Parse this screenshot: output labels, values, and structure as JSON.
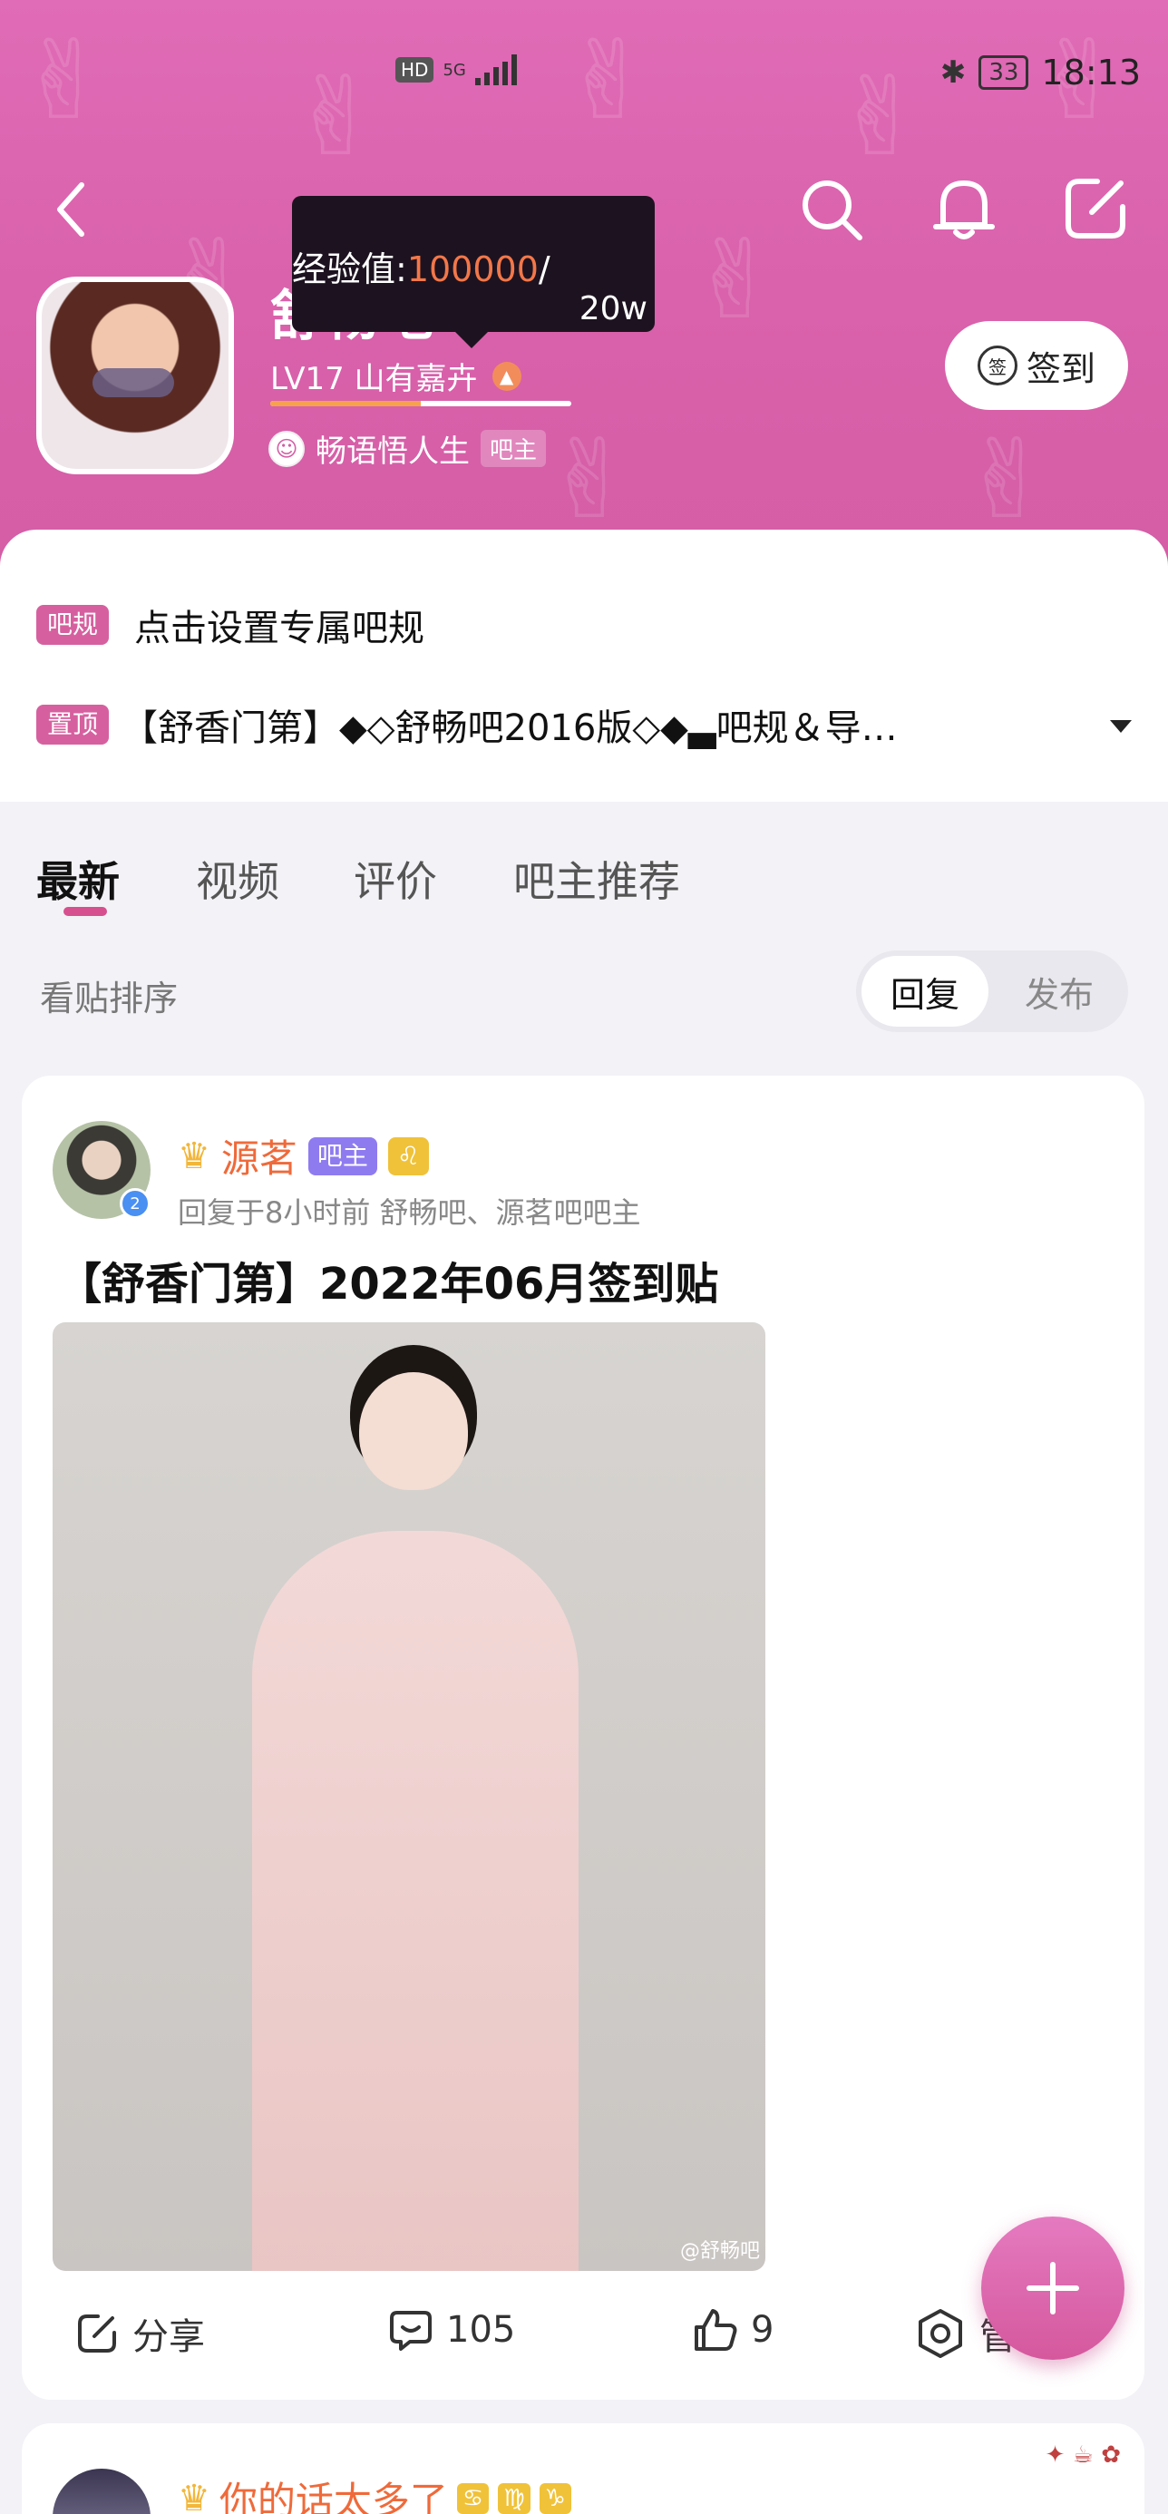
{
  "status": {
    "network_badge": "HD",
    "network_type": "5G",
    "battery": "33",
    "time": "18:13"
  },
  "forum": {
    "name": "舒畅吧",
    "level": "LV17 山有嘉卉",
    "xp_progress_fraction": 0.5,
    "owner_name": "畅语悟人生",
    "owner_badge": "吧主",
    "sign_in_label": "签到",
    "sign_in_icon": "签"
  },
  "tooltip": {
    "label": "经验值:",
    "value": "100000",
    "separator": "/",
    "total": "20w"
  },
  "rules": {
    "rule_tag": "吧规",
    "rule_text": "点击设置专属吧规",
    "pin_tag": "置顶",
    "pin_text": "【舒香门第】◆◇舒畅吧2016版◇◆▃吧规＆导…"
  },
  "tabs": [
    "最新",
    "视频",
    "评价",
    "吧主推荐"
  ],
  "sort": {
    "label": "看贴排序",
    "options": [
      "回复",
      "发布"
    ],
    "selected": "回复"
  },
  "post": {
    "author": "源茗",
    "role_badge": "吧主",
    "zodiac": "♌",
    "verify_level": "2",
    "meta": "回复于8小时前  舒畅吧、源茗吧吧主",
    "title": "【舒香门第】2022年06月签到贴",
    "image_watermark": "@舒畅吧",
    "share_label": "分享",
    "comments": "105",
    "likes": "9",
    "manage_label": "管"
  },
  "post2": {
    "author": "你的话太多了",
    "zodiacs": [
      "♋",
      "♍",
      "♑"
    ]
  },
  "colors": {
    "header": "#d960aa",
    "accent": "#d6609f",
    "author_name": "#ef6a3a"
  }
}
